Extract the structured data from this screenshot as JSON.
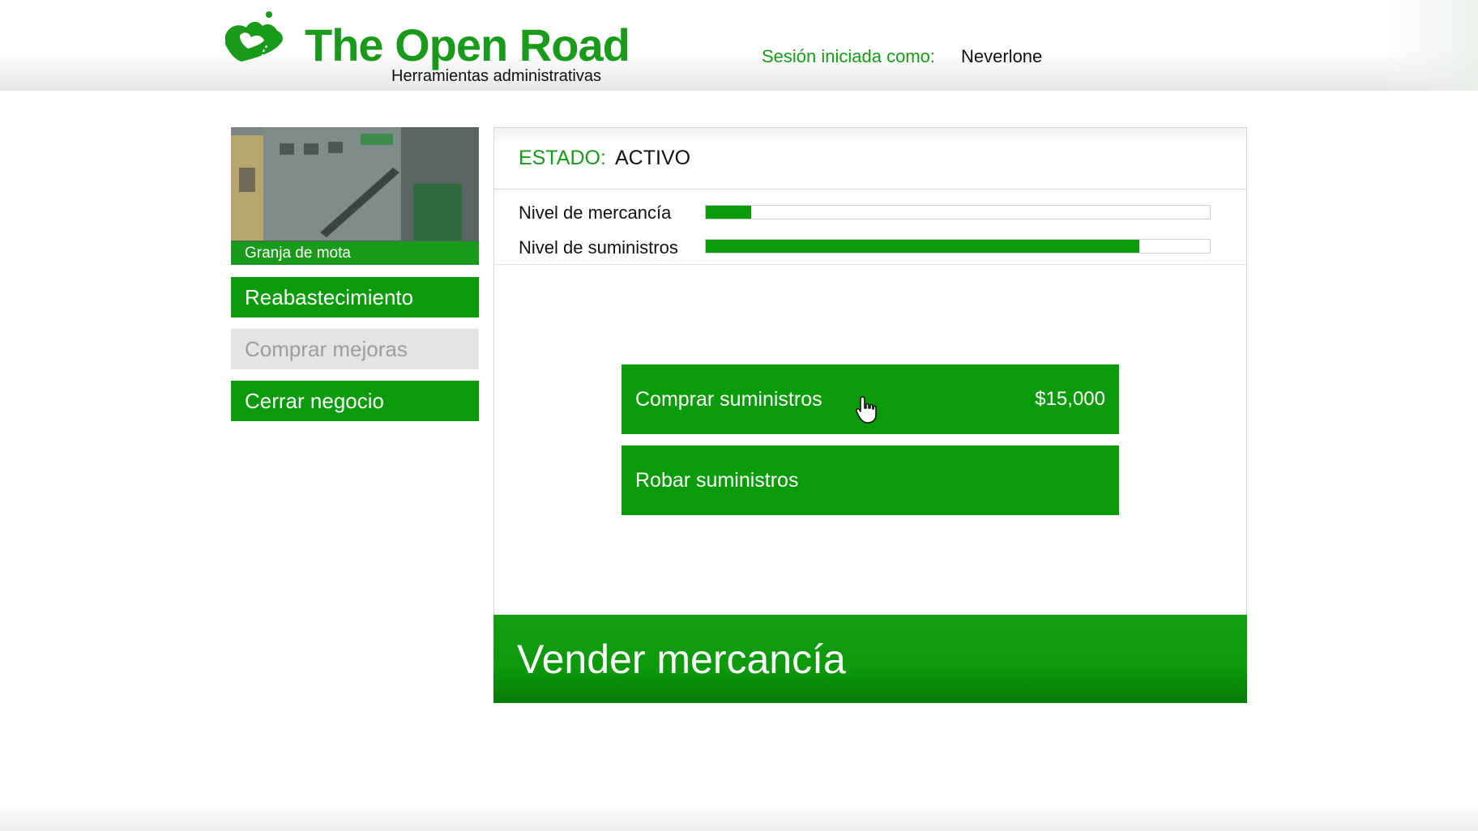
{
  "header": {
    "brand_title": "The Open Road",
    "brand_subtitle": "Herramientas administrativas",
    "session_label": "Sesión iniciada como:",
    "session_user": "Neverlone"
  },
  "sidebar": {
    "thumbnail_caption": "Granja de mota",
    "items": [
      {
        "label": "Reabastecimiento",
        "state": "active"
      },
      {
        "label": "Comprar mejoras",
        "state": "disabled"
      },
      {
        "label": "Cerrar negocio",
        "state": "active"
      }
    ]
  },
  "status": {
    "label": "ESTADO:",
    "value": "ACTIVO"
  },
  "levels": [
    {
      "label": "Nivel de mercancía",
      "fraction": 0.09
    },
    {
      "label": "Nivel de suministros",
      "fraction": 0.86
    }
  ],
  "actions": {
    "buy_supplies": {
      "label": "Comprar suministros",
      "price": "$15,000"
    },
    "steal_supplies": {
      "label": "Robar suministros"
    },
    "sell_product": {
      "label": "Vender mercancía"
    }
  },
  "colors": {
    "accent_green": "#0a9b0a",
    "brand_green": "#1a9a1a",
    "disabled_gray": "#e4e4e4"
  },
  "icons": {
    "logo": "road-hill-logo-icon",
    "cursor": "hand-pointer-icon"
  }
}
